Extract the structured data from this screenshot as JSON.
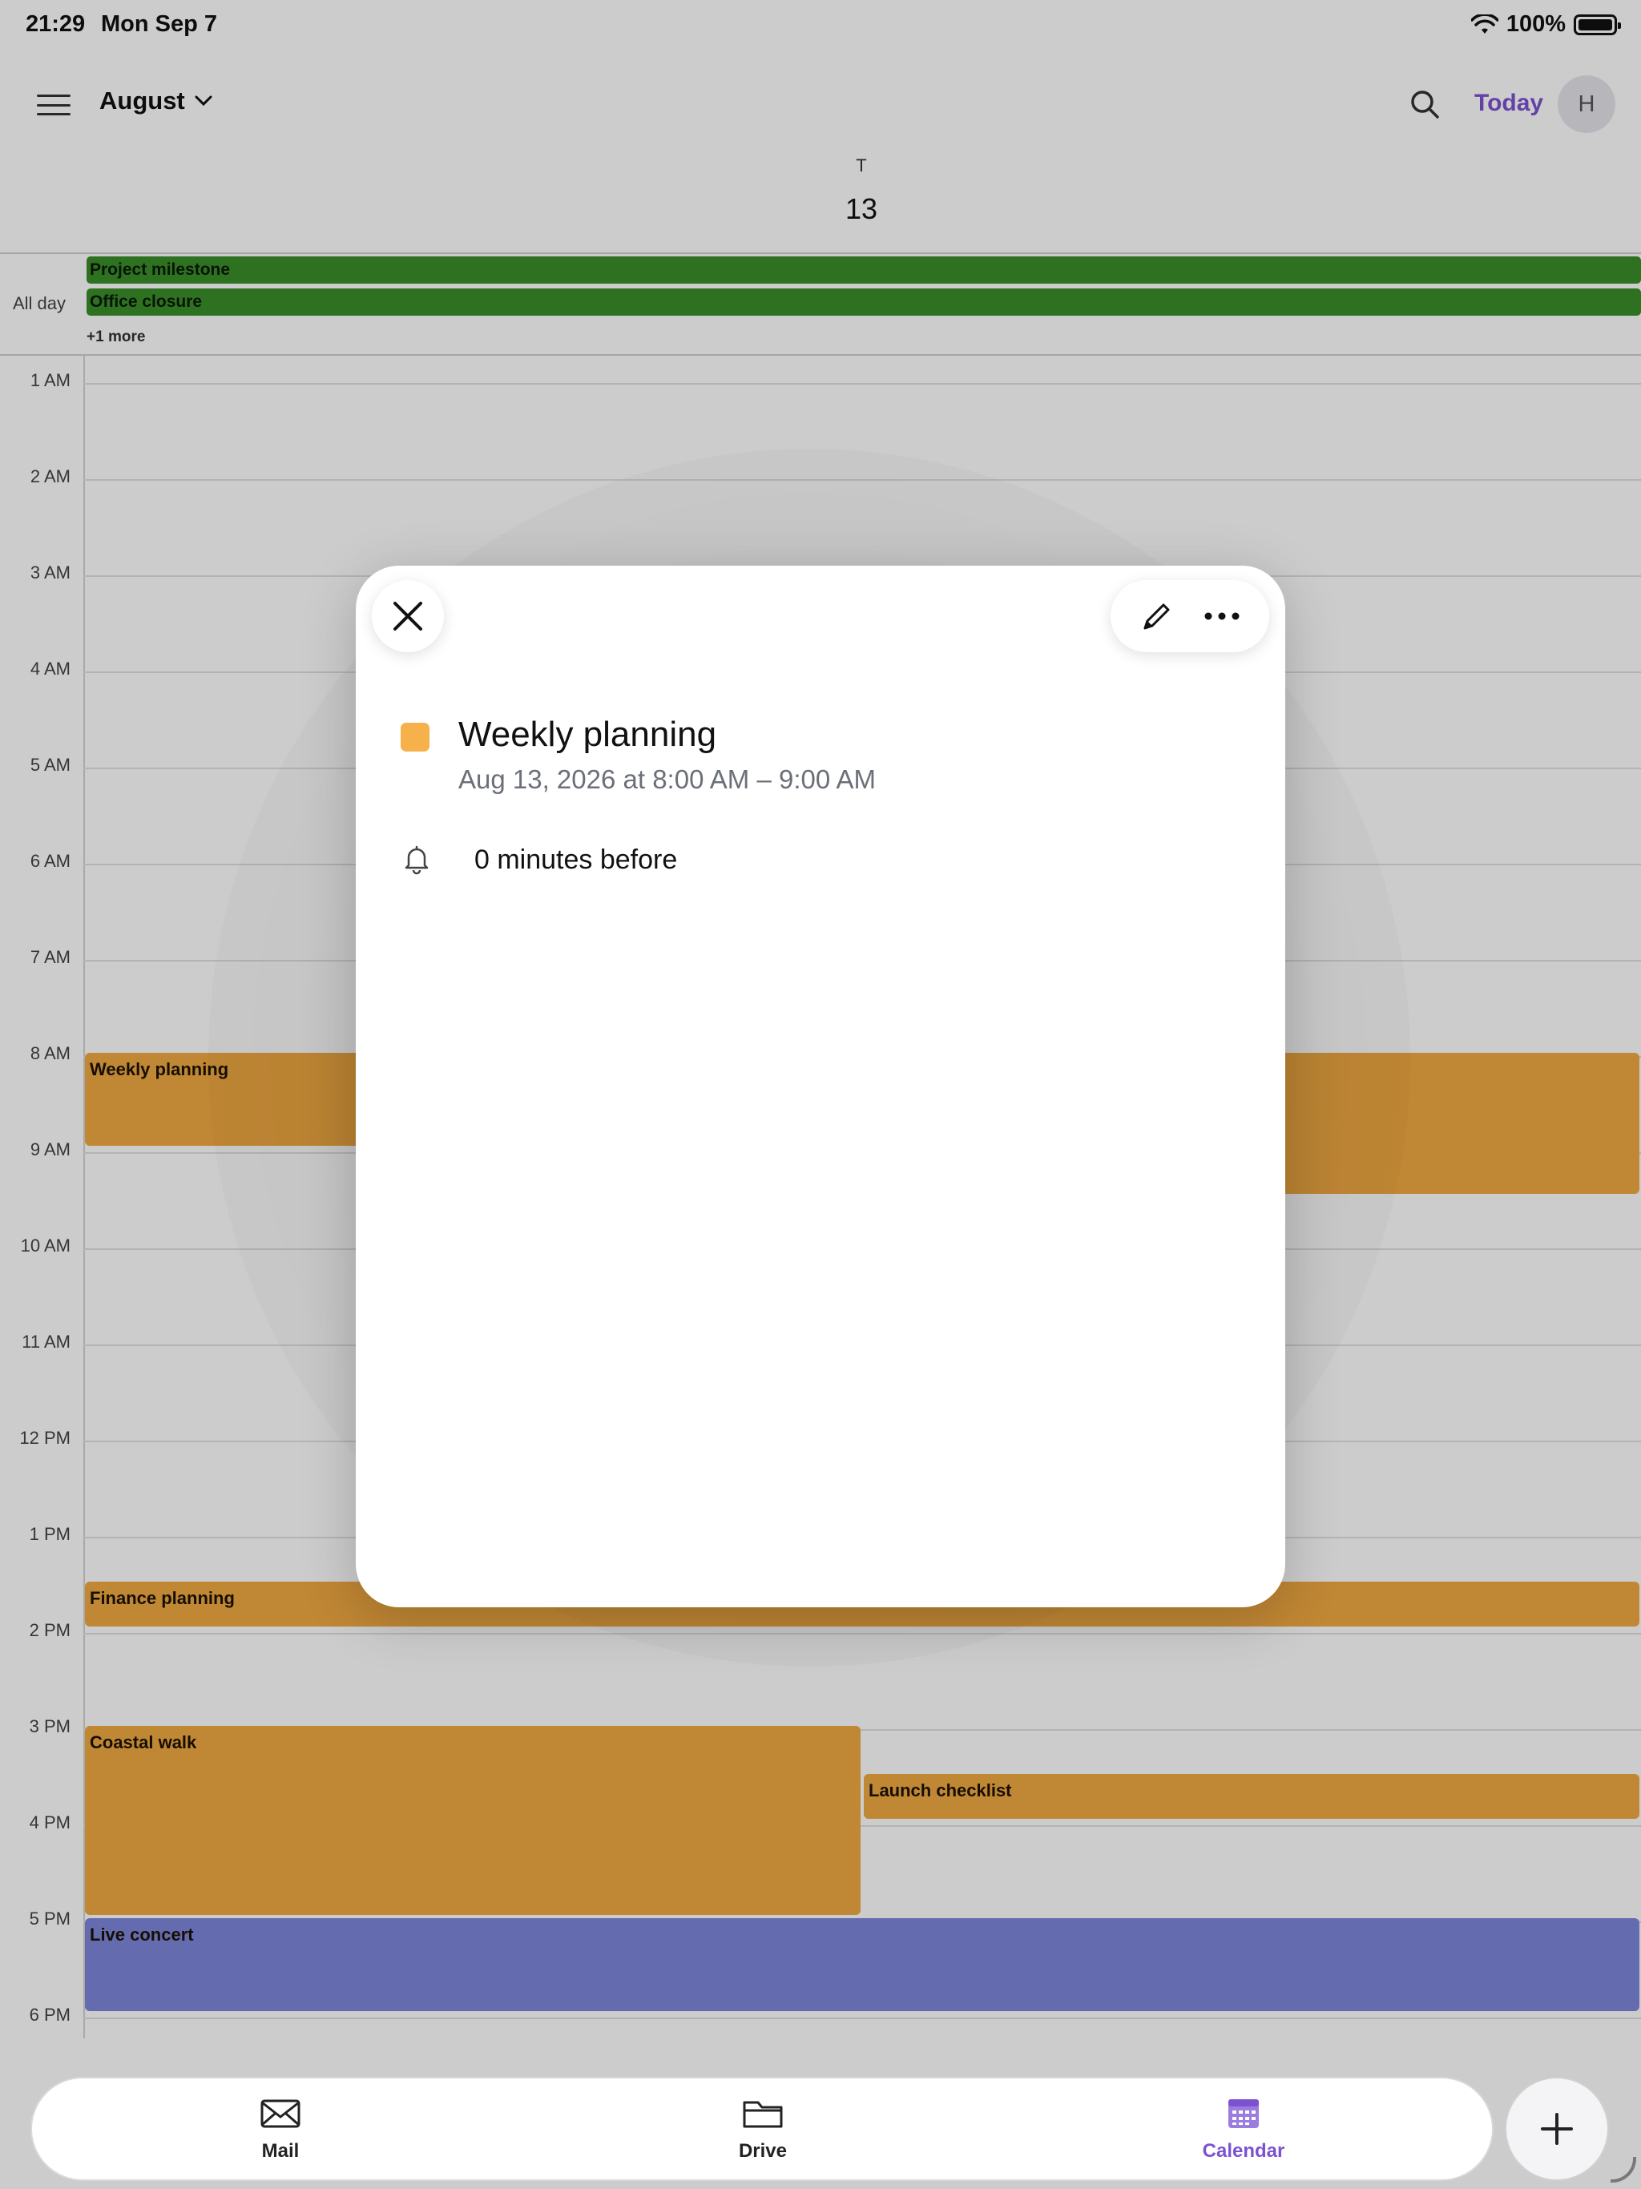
{
  "status_bar": {
    "time": "21:29",
    "date": "Mon Sep 7",
    "battery": "100%"
  },
  "top_bar": {
    "month": "August",
    "today_label": "Today",
    "avatar_initial": "H"
  },
  "day_header": {
    "weekday": "T",
    "day": "13"
  },
  "all_day": {
    "label": "All day",
    "events": [
      "Project milestone",
      "Office closure"
    ],
    "more": "+1 more",
    "color": "#3a8f2a"
  },
  "timeline": {
    "hours": [
      "1 AM",
      "2 AM",
      "3 AM",
      "4 AM",
      "5 AM",
      "6 AM",
      "7 AM",
      "8 AM",
      "9 AM",
      "10 AM",
      "11 AM",
      "12 PM",
      "1 PM",
      "2 PM",
      "3 PM",
      "4 PM",
      "5 PM",
      "6 PM"
    ],
    "events": [
      {
        "title": "Weekly planning",
        "color": "#f0a941"
      },
      {
        "title": "",
        "color": "#f0a941"
      },
      {
        "title": "Finance planning",
        "color": "#f0a941"
      },
      {
        "title": "Coastal walk",
        "color": "#f0a941"
      },
      {
        "title": "Launch checklist",
        "color": "#f0a941"
      },
      {
        "title": "Live concert",
        "color": "#7d87db"
      }
    ]
  },
  "modal": {
    "title": "Weekly planning",
    "datetime": "Aug 13, 2026 at 8:00 AM – 9:00 AM",
    "reminder": "0 minutes before",
    "color": "#f7b14b"
  },
  "tabbar": {
    "tabs": [
      {
        "label": "Mail",
        "icon": "mail-icon"
      },
      {
        "label": "Drive",
        "icon": "folder-icon"
      },
      {
        "label": "Calendar",
        "icon": "calendar-icon",
        "active": true
      }
    ],
    "accent": "#7c52d1"
  }
}
